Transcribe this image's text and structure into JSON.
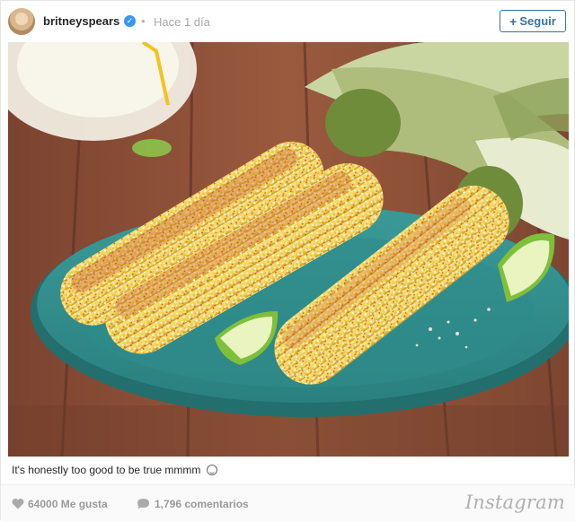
{
  "header": {
    "username": "britneyspears",
    "verified_icon": "verified-badge-icon",
    "separator": "•",
    "timestamp": "Hace 1 día",
    "follow_plus": "+",
    "follow_label": "Seguir"
  },
  "post": {
    "image_alt": "grilled corn on the cob with cheese, chili powder and lime wedges on a teal plate"
  },
  "caption": {
    "text": "It's honestly too good to be true mmmm",
    "emoji_icon": "smile-emoji-icon"
  },
  "footer": {
    "likes": "64000 Me gusta",
    "comments": "1,796 comentarios",
    "brand": "Instagram"
  },
  "colors": {
    "accent_blue": "#3f729b",
    "verified_blue": "#3897f0",
    "muted_gray": "#9a9a9a"
  }
}
